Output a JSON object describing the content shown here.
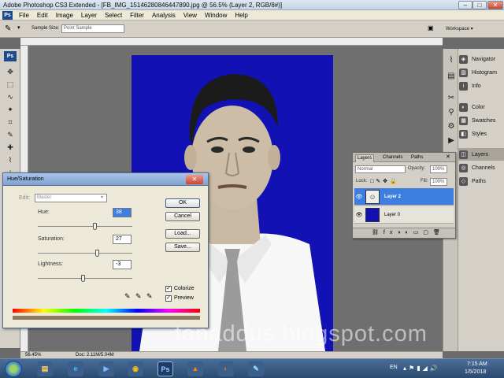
{
  "window": {
    "title": "Adobe Photoshop CS3 Extended - [FB_IMG_15146280846447890.jpg @ 56.5% (Layer 2, RGB/8#)]",
    "controls": {
      "minimize": "–",
      "maximize": "□",
      "close": "✕"
    }
  },
  "menu": {
    "logo": "Ps",
    "items": [
      "File",
      "Edit",
      "Image",
      "Layer",
      "Select",
      "Filter",
      "Analysis",
      "View",
      "Window",
      "Help"
    ]
  },
  "options_bar": {
    "sample_size_label": "Sample Size:",
    "sample_size_value": "Point Sample",
    "workspace_label": "Workspace ▾"
  },
  "toolbox": {
    "logo": "Ps",
    "icons": [
      "move-icon",
      "marquee-icon",
      "lasso-icon",
      "magic-wand-icon",
      "crop-icon",
      "eyedropper-icon",
      "healing-icon",
      "brush-icon",
      "stamp-icon",
      "history-brush-icon",
      "eraser-icon",
      "gradient-icon",
      "blur-icon",
      "dodge-icon",
      "pen-icon",
      "type-icon",
      "path-select-icon",
      "shape-icon",
      "notes-icon",
      "hand-icon",
      "zoom-icon"
    ]
  },
  "dialog": {
    "title": "Hue/Saturation",
    "edit_label": "Edit:",
    "edit_value": "Master",
    "hue": {
      "label": "Hue:",
      "value": "38",
      "level": 0.605
    },
    "saturation": {
      "label": "Saturation:",
      "value": "27",
      "level": 0.635
    },
    "lightness": {
      "label": "Lightness:",
      "value": "-3",
      "level": 0.485
    },
    "buttons": {
      "ok": "OK",
      "cancel": "Cancel",
      "load": "Load...",
      "save": "Save..."
    },
    "colorize": {
      "label": "Colorize",
      "checked": true
    },
    "preview": {
      "label": "Preview",
      "checked": true
    }
  },
  "dock": {
    "group1": [
      "Navigator",
      "Histogram",
      "Info"
    ],
    "group2": [
      "Color",
      "Swatches",
      "Styles"
    ],
    "group3": [
      "Layers",
      "Channels",
      "Paths"
    ]
  },
  "layers_panel": {
    "tabs": [
      "Layers",
      "Channels",
      "Paths"
    ],
    "blend_mode": "Normal",
    "opacity_label": "Opacity:",
    "opacity_value": "100%",
    "lock_label": "Lock:",
    "fill_label": "Fill:",
    "fill_value": "100%",
    "layers": [
      {
        "name": "Layer 2",
        "selected": true
      },
      {
        "name": "Layer 0",
        "selected": false
      }
    ]
  },
  "status_bar": {
    "zoom": "56.45%",
    "doc": "Doc: 2.11M/5.04M"
  },
  "watermark": "tanaddus.blogspot.com",
  "taskbar": {
    "language": "EN",
    "time": "7:15 AM",
    "date": "1/5/2018"
  },
  "colors": {
    "photo_background": "#1212b4",
    "selected_layer": "#3d7fe0",
    "dialog_title": "#8fb0dc"
  }
}
